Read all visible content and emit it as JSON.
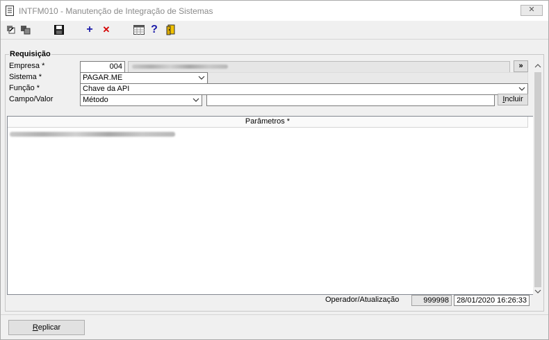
{
  "window": {
    "title": "INTFM010 - Manutenção de Integração de Sistemas",
    "close_symbol": "✕"
  },
  "toolbar": {
    "icons": [
      "nav-back-icon",
      "copy-icon",
      "save-icon",
      "add-icon",
      "delete-icon",
      "calendar-grid-icon",
      "help-icon",
      "exit-door-icon"
    ],
    "add_symbol": "+",
    "delete_symbol": "✕",
    "help_symbol": "?",
    "colors": {
      "add": "#1a1aa8",
      "delete": "#d40000",
      "help": "#1a1aa8"
    }
  },
  "group": {
    "title": "Requisição"
  },
  "form": {
    "empresa_label": "Empresa *",
    "empresa_code": "004",
    "lookup_label": "»",
    "sistema_label": "Sistema *",
    "sistema_value": "PAGAR.ME",
    "funcao_label": "Função *",
    "funcao_value": "Chave da API",
    "campo_label": "Campo/Valor",
    "campo_value": "Método",
    "valor_value": "",
    "incluir_label": "Incluir"
  },
  "grid": {
    "header": "Parâmetros *"
  },
  "status": {
    "label": "Operador/Atualização",
    "operator": "999998",
    "timestamp": "28/01/2020 16:26:33"
  },
  "footer": {
    "replicar_label": "Replicar"
  }
}
